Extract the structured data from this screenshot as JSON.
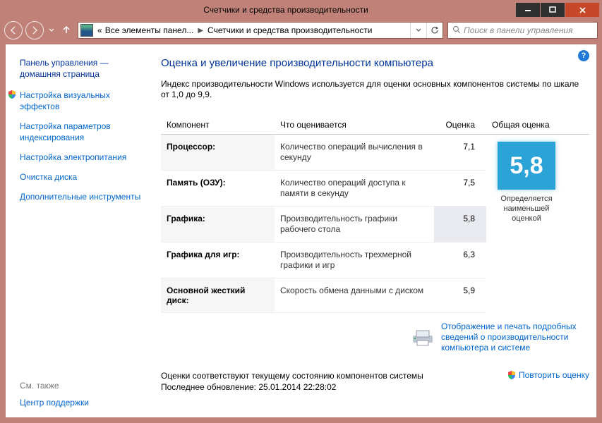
{
  "window": {
    "title": "Счетчики и средства производительности"
  },
  "nav": {
    "breadcrumb_pre": "«",
    "breadcrumb1": "Все элементы панел...",
    "breadcrumb2": "Счетчики и средства производительности",
    "search_placeholder": "Поиск в панели управления"
  },
  "sidebar": {
    "home1": "Панель управления —",
    "home2": "домашняя страница",
    "links": [
      "Настройка визуальных эффектов",
      "Настройка параметров индексирования",
      "Настройка электропитания",
      "Очистка диска",
      "Дополнительные инструменты"
    ],
    "see_also_hdr": "См. также",
    "see_also_link": "Центр поддержки"
  },
  "main": {
    "heading": "Оценка и увеличение производительности компьютера",
    "desc": "Индекс производительности Windows используется для оценки основных компонентов системы по шкале от 1,0 до 9,9.",
    "col_component": "Компонент",
    "col_what": "Что оценивается",
    "col_score": "Оценка",
    "col_base": "Общая оценка",
    "rows": [
      {
        "comp": "Процессор:",
        "what": "Количество операций вычисления в секунду",
        "score": "7,1"
      },
      {
        "comp": "Память (ОЗУ):",
        "what": "Количество операций доступа к памяти в секунду",
        "score": "7,5"
      },
      {
        "comp": "Графика:",
        "what": "Производительность графики рабочего стола",
        "score": "5,8"
      },
      {
        "comp": "Графика для игр:",
        "what": "Производительность трехмерной графики и игр",
        "score": "6,3"
      },
      {
        "comp": "Основной жесткий диск:",
        "what": "Скорость обмена данными с диском",
        "score": "5,9"
      }
    ],
    "base_score": "5,8",
    "base_caption": "Определяется наименьшей оценкой",
    "print_link": "Отображение и печать подробных сведений о производительности компьютера и системе",
    "status1": "Оценки соответствуют текущему состоянию компонентов системы",
    "status2": "Последнее обновление: 25.01.2014 22:28:02",
    "rerun": "Повторить оценку"
  },
  "help": "?"
}
